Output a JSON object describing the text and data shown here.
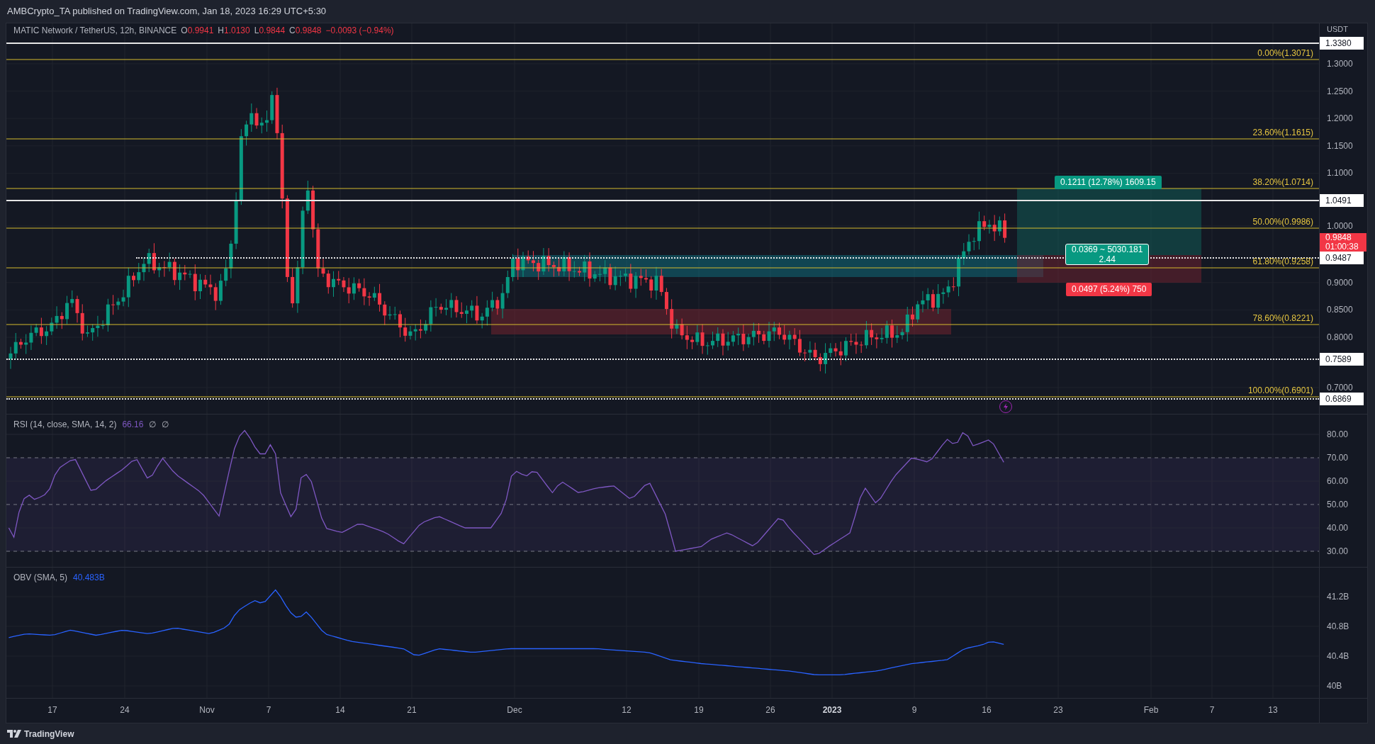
{
  "header": {
    "publisher_line": "AMBCrypto_TA published on TradingView.com, Jan 18, 2023 16:29 UTC+5:30"
  },
  "legend": {
    "symbol": "MATIC Network / TetherUS, 12h, BINANCE",
    "ohlc": [
      {
        "label": "O",
        "value": "0.9941"
      },
      {
        "label": "H",
        "value": "1.0130"
      },
      {
        "label": "L",
        "value": "0.9844"
      },
      {
        "label": "C",
        "value": "0.9848"
      }
    ],
    "change": "−0.0093 (−0.94%)"
  },
  "price_axis": {
    "unit": "USDT",
    "ticks": [
      "1.3000",
      "1.2500",
      "1.2000",
      "1.1500",
      "1.1000",
      "1.0000",
      "0.9000",
      "0.8500",
      "0.8000",
      "0.7000"
    ]
  },
  "price_tags": [
    {
      "kind": "level",
      "text": "1.3380",
      "dotted": false
    },
    {
      "kind": "level",
      "text": "1.0491",
      "dotted": false
    },
    {
      "kind": "current",
      "text": "0.9848",
      "countdown": "01:00:38"
    },
    {
      "kind": "level",
      "text": "0.9487",
      "dotted": true
    },
    {
      "kind": "level",
      "text": "0.7589",
      "dotted": true
    },
    {
      "kind": "level",
      "text": "0.6869",
      "dotted": true
    }
  ],
  "fib_levels": [
    "0.00%(1.3071)",
    "23.60%(1.1615)",
    "38.20%(1.0714)",
    "50.00%(0.9986)",
    "61.80%(0.9258)",
    "78.60%(0.8221)",
    "100.00%(0.6901)"
  ],
  "position": {
    "target_label": "0.1211 (12.78%) 1609.15",
    "entry_label": [
      "0.0369 ~ 5030.181",
      "2.44"
    ],
    "stop_label": "0.0497 (5.24%) 750"
  },
  "rsi": {
    "legend": "RSI (14, close, SMA, 14, 2)",
    "value": "66.16",
    "extras": [
      "∅",
      "∅"
    ],
    "ticks": [
      "80.00",
      "70.00",
      "60.00",
      "50.00",
      "40.00",
      "30.00"
    ]
  },
  "obv": {
    "legend": "OBV (SMA, 5)",
    "value": "40.483B",
    "ticks": [
      "41.2B",
      "40.8B",
      "40.4B",
      "40B"
    ]
  },
  "time_axis": [
    {
      "label": "17",
      "kind": "day"
    },
    {
      "label": "24",
      "kind": "day"
    },
    {
      "label": "Nov",
      "kind": "month"
    },
    {
      "label": "7",
      "kind": "day"
    },
    {
      "label": "14",
      "kind": "day"
    },
    {
      "label": "21",
      "kind": "day"
    },
    {
      "label": "Dec",
      "kind": "month"
    },
    {
      "label": "12",
      "kind": "day"
    },
    {
      "label": "19",
      "kind": "day"
    },
    {
      "label": "26",
      "kind": "day"
    },
    {
      "label": "2023",
      "kind": "year"
    },
    {
      "label": "9",
      "kind": "day"
    },
    {
      "label": "16",
      "kind": "day"
    },
    {
      "label": "23",
      "kind": "day"
    },
    {
      "label": "Feb",
      "kind": "month"
    },
    {
      "label": "7",
      "kind": "day"
    },
    {
      "label": "13",
      "kind": "day"
    }
  ],
  "footer": {
    "brand": "TradingView"
  }
}
